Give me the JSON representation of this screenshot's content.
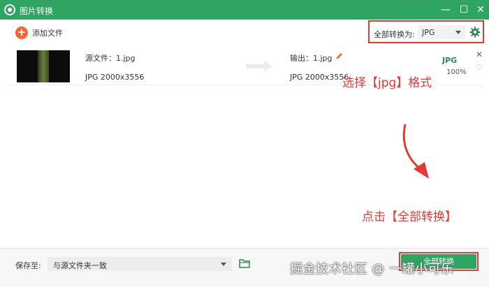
{
  "window": {
    "title": "图片转换",
    "controls": [
      "—",
      "☐",
      "✕"
    ]
  },
  "toolbar": {
    "add_file_label": "添加文件",
    "convert_all_label": "全部转换为:",
    "format_value": "JPG",
    "settings_icon": "gear-icon"
  },
  "file": {
    "source_name": "源文件：1.jpg",
    "source_info": "JPG   2000x3556",
    "output_name": "输出：1.jpg",
    "output_info": "JPG   2000x3556",
    "format_badge": "JPG",
    "progress_text": "100%",
    "progress": 1.0
  },
  "annotations": {
    "select_format": "选择【jpg】格式",
    "click_convert": "点击【全部转换】"
  },
  "footer": {
    "save_to_label": "保存至:",
    "save_to_value": "与源文件夹一致",
    "convert_button_label": "全部转换"
  },
  "watermark": "掘金技术社区 @ 一罐小可乐",
  "colors": {
    "accent_green": "#2fa463",
    "highlight_red": "#e53935",
    "add_orange": "#f5642c"
  }
}
